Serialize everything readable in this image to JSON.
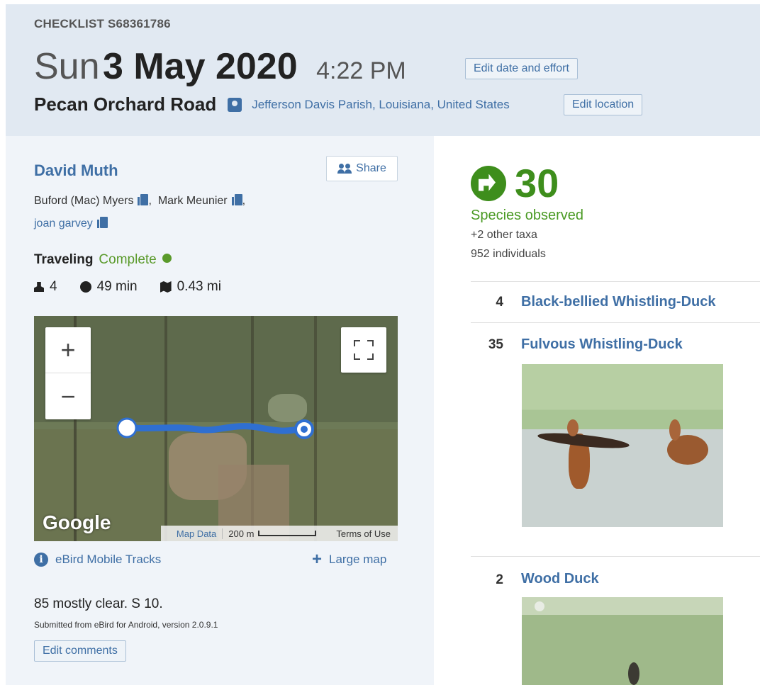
{
  "header": {
    "checklist_id": "CHECKLIST S68361786",
    "date_day": "Sun",
    "date_main": "3 May 2020",
    "time": "4:22 PM",
    "edit_date_label": "Edit date and effort",
    "location_name": "Pecan Orchard Road",
    "location_parts": "Jefferson Davis Parish,  Louisiana,  United States",
    "edit_location_label": "Edit location"
  },
  "observers": {
    "owner": "David Muth",
    "share_label": "Share",
    "others": [
      "Buford (Mac) Myers",
      "Mark Meunier",
      "joan garvey"
    ]
  },
  "effort": {
    "protocol": "Traveling",
    "status": "Complete",
    "party_size": "4",
    "duration": "49 min",
    "distance": "0.43 mi"
  },
  "map": {
    "zoom_in": "+",
    "zoom_out": "−",
    "logo": "Google",
    "map_data_label": "Map Data",
    "scale_label": "200 m",
    "terms_label": "Terms of Use",
    "track_start": [
      0.25,
      0.5
    ],
    "track_end": [
      0.75,
      0.5
    ]
  },
  "links": {
    "tracks": "eBird Mobile Tracks",
    "large_map": "Large map"
  },
  "comments": {
    "text": "85 mostly clear. S 10.",
    "submitted": "Submitted from eBird for Android, version 2.0.9.1",
    "edit_label": "Edit comments"
  },
  "summary": {
    "species_count": "30",
    "species_label": "Species observed",
    "other_taxa": "+2 other taxa",
    "individuals": "952 individuals"
  },
  "observations": [
    {
      "count": "4",
      "name": "Black-bellied Whistling-Duck"
    },
    {
      "count": "35",
      "name": "Fulvous Whistling-Duck"
    },
    {
      "count": "2",
      "name": "Wood Duck"
    }
  ],
  "colors": {
    "accent": "#3f6fa5",
    "species_green": "#3e8e1c",
    "header_bg": "#e1e9f2",
    "left_bg": "#f0f4f9"
  }
}
